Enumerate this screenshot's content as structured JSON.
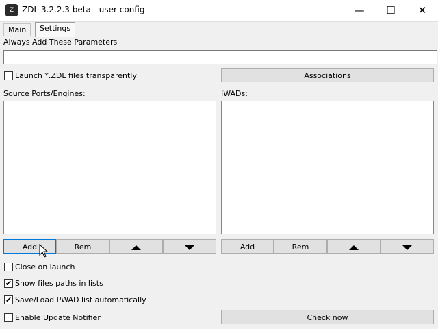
{
  "window": {
    "title": "ZDL 3.2.2.3 beta - user config",
    "controls": {
      "minimize_icon": "—",
      "maximize_icon": "☐",
      "close_icon": "✕"
    }
  },
  "tabs": [
    {
      "label": "Main",
      "active": false
    },
    {
      "label": "Settings",
      "active": true
    }
  ],
  "settings": {
    "always_add_label": "Always Add These Parameters",
    "always_add_value": "",
    "launch_transparent": {
      "label": "Launch *.ZDL files transparently",
      "checked": false
    },
    "associations_label": "Associations",
    "source_ports_label": "Source Ports/Engines:",
    "iwads_label": "IWADs:",
    "source_ports_buttons": {
      "add": "Add",
      "rem": "Rem"
    },
    "iwads_buttons": {
      "add": "Add",
      "rem": "Rem"
    },
    "close_on_launch": {
      "label": "Close on launch",
      "checked": false
    },
    "show_paths": {
      "label": "Show files paths in lists",
      "checked": true
    },
    "save_load_pwad": {
      "label": "Save/Load PWAD list automatically",
      "checked": true
    },
    "update_notifier": {
      "label": "Enable Update Notifier",
      "checked": false
    },
    "check_now_label": "Check now",
    "check_mark": "✔"
  },
  "colors": {
    "accent": "#0078d7",
    "button_face": "#e1e1e1"
  }
}
